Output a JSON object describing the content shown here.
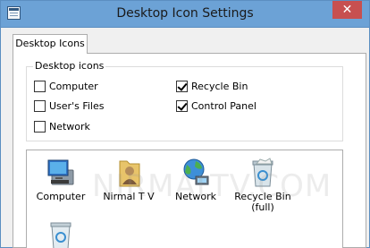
{
  "window": {
    "title": "Desktop Icon Settings",
    "close_glyph": "✕"
  },
  "tab": {
    "label": "Desktop Icons"
  },
  "group": {
    "label": "Desktop icons",
    "checkboxes": [
      {
        "label": "Computer",
        "checked": false
      },
      {
        "label": "Recycle Bin",
        "checked": true
      },
      {
        "label": "User's Files",
        "checked": false
      },
      {
        "label": "Control Panel",
        "checked": true
      },
      {
        "label": "Network",
        "checked": false
      }
    ]
  },
  "icons": [
    {
      "label": "Computer",
      "icon": "computer-icon"
    },
    {
      "label": "Nirmal T V",
      "icon": "user-folder-icon"
    },
    {
      "label": "Network",
      "icon": "network-icon"
    },
    {
      "label": "Recycle Bin (full)",
      "icon": "recycle-bin-full-icon"
    },
    {
      "label": "",
      "icon": "recycle-bin-empty-icon"
    }
  ],
  "watermark": "NIRMALTV.COM"
}
